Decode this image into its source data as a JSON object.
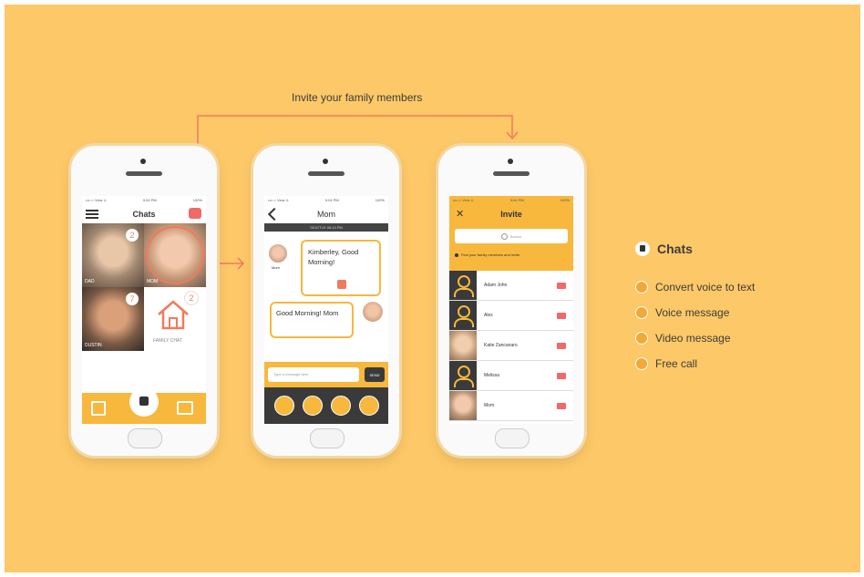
{
  "caption": "Invite your family members",
  "phone1": {
    "title": "Chats",
    "tiles": [
      {
        "label": "DAD",
        "badge": "2"
      },
      {
        "label": "MOM",
        "badge": ""
      },
      {
        "label": "DUSTIN",
        "badge": "7"
      },
      {
        "label": "FAMILY CHAT",
        "badge": "2"
      }
    ]
  },
  "phone2": {
    "title": "Mom",
    "location": "SEATTLE 08:14 PM",
    "msg1_sender": "Mom",
    "msg1_text": "Kimberley, Good Morning!",
    "msg2_text": "Good Morning! Mom",
    "input_placeholder": "Type a message here",
    "send_label": "SEND"
  },
  "phone3": {
    "title": "Invite",
    "search_placeholder": "Search",
    "hint": "Find your family members and invite.",
    "contacts": [
      "Adam John",
      "Alex",
      "Katie Zancanaro",
      "Melissa",
      "Mom"
    ]
  },
  "status": {
    "carrier": "•••○○ Vera ≎",
    "time": "9:04 PM",
    "battery": "100%"
  },
  "legend": {
    "title": "Chats",
    "items": [
      {
        "icon": "voice-to-text-icon",
        "label": "Convert voice to text"
      },
      {
        "icon": "microphone-icon",
        "label": "Voice message"
      },
      {
        "icon": "video-camera-icon",
        "label": "Video message"
      },
      {
        "icon": "phone-icon",
        "label": "Free call"
      }
    ]
  },
  "colors": {
    "background": "#fdc867",
    "accent": "#f7b83d",
    "coral": "#f07a5e"
  }
}
